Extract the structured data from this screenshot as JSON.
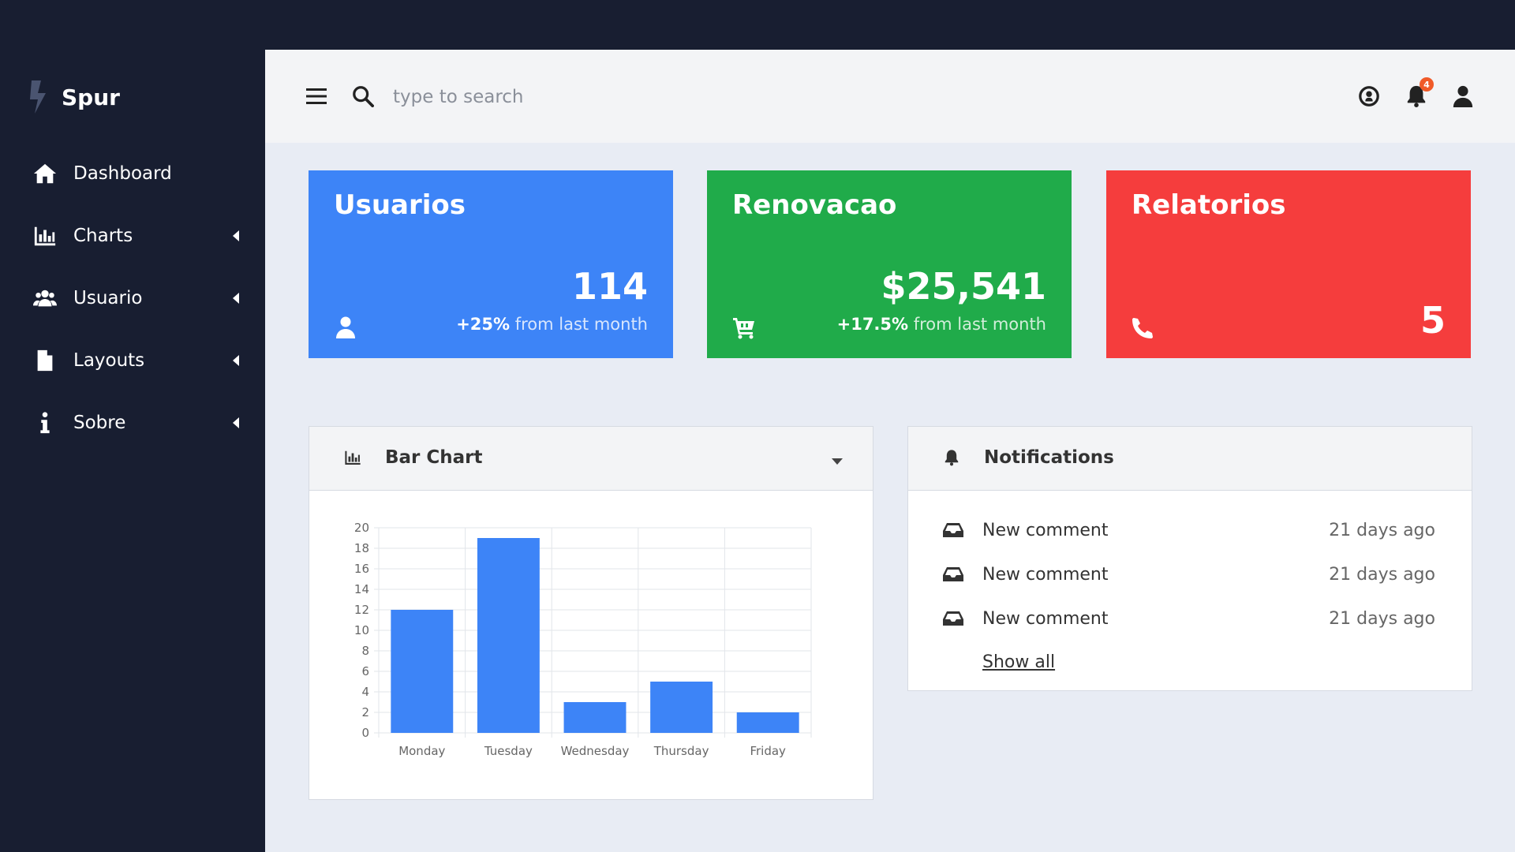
{
  "brand": {
    "name": "Spur"
  },
  "sidebar": {
    "items": [
      {
        "label": "Dashboard",
        "icon": "home-icon",
        "has_submenu": false
      },
      {
        "label": "Charts",
        "icon": "chart-icon",
        "has_submenu": true
      },
      {
        "label": "Usuario",
        "icon": "users-icon",
        "has_submenu": true
      },
      {
        "label": "Layouts",
        "icon": "file-icon",
        "has_submenu": true
      },
      {
        "label": "Sobre",
        "icon": "info-icon",
        "has_submenu": true
      }
    ]
  },
  "topbar": {
    "search_placeholder": "type to search",
    "notification_count": "4"
  },
  "cards": [
    {
      "title": "Usuarios",
      "value": "114",
      "change": "+25%",
      "change_text": " from last month",
      "icon": "user-icon",
      "color": "#3d84f7"
    },
    {
      "title": "Renovacao",
      "value": "$25,541",
      "change": "+17.5%",
      "change_text": " from last month",
      "icon": "cart-icon",
      "color": "#20ab4a"
    },
    {
      "title": "Relatorios",
      "value": "5",
      "icon": "phone-icon",
      "color": "#f53d3d"
    }
  ],
  "bar_panel": {
    "title": "Bar Chart"
  },
  "notifications_panel": {
    "title": "Notifications",
    "items": [
      {
        "text": "New comment",
        "time": "21 days ago"
      },
      {
        "text": "New comment",
        "time": "21 days ago"
      },
      {
        "text": "New comment",
        "time": "21 days ago"
      }
    ],
    "show_all": "Show all"
  },
  "chart_data": {
    "type": "bar",
    "categories": [
      "Monday",
      "Tuesday",
      "Wednesday",
      "Thursday",
      "Friday"
    ],
    "values": [
      12,
      19,
      3,
      5,
      2
    ],
    "ylim": [
      0,
      20
    ],
    "yticks": [
      0,
      2,
      4,
      6,
      8,
      10,
      12,
      14,
      16,
      18,
      20
    ],
    "bar_color": "#3d84f7",
    "grid": true
  }
}
